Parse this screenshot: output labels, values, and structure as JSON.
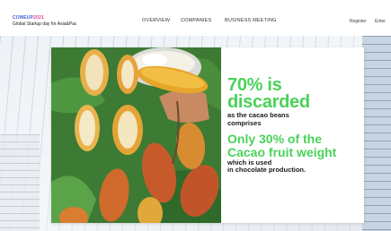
{
  "header": {
    "logo": {
      "brand_part1": "COMEUP",
      "brand_part2": "2021",
      "tagline": "Global Startup day for Asia&Pac"
    },
    "nav": {
      "overview": "OVERVIEW",
      "companies": "COMPANIES",
      "business_meeting": "BUSINESS MEETING"
    },
    "actions": {
      "register": "Register",
      "enter": "Enter"
    }
  },
  "slide": {
    "headline_line1": "70% is",
    "headline_line2": "discarded",
    "sub_line1": "as the cacao beans",
    "sub_line2": "comprises",
    "highlight_line1": "Only 30% of  the",
    "highlight_line2": "Cacao fruit weight",
    "detail_line1": "which is used",
    "detail_line2": "in chocolate production."
  },
  "colors": {
    "accent_green": "#4bd15a",
    "logo_blue": "#3c5fd6",
    "logo_pink": "#e0408a"
  },
  "icons": [
    "cacao-photo"
  ]
}
